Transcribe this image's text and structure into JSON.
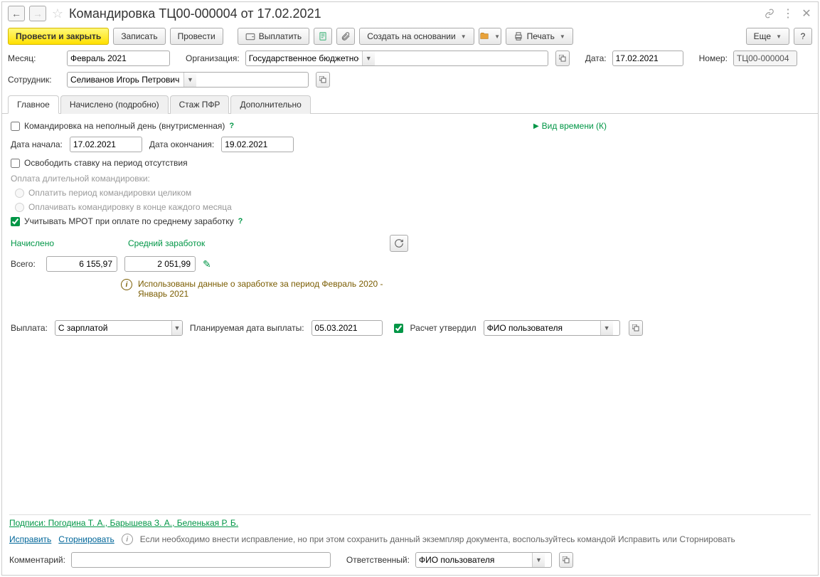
{
  "title": "Командировка ТЦ00-000004 от 17.02.2021",
  "toolbar": {
    "post_close": "Провести и закрыть",
    "save": "Записать",
    "post": "Провести",
    "pay": "Выплатить",
    "create_based": "Создать на основании",
    "print": "Печать",
    "more": "Еще"
  },
  "header": {
    "month_label": "Месяц:",
    "month_value": "Февраль 2021",
    "org_label": "Организация:",
    "org_value": "Государственное бюджетное учреждение культуры \"Театральный центр",
    "date_label": "Дата:",
    "date_value": "17.02.2021",
    "number_label": "Номер:",
    "number_value": "ТЦ00-000004",
    "employee_label": "Сотрудник:",
    "employee_value": "Селиванов Игорь Петрович"
  },
  "tabs": {
    "main": "Главное",
    "accrued": "Начислено (подробно)",
    "pfr": "Стаж ПФР",
    "extra": "Дополнительно"
  },
  "main_tab": {
    "partial_day": "Командировка на неполный день (внутрисменная)",
    "time_kind": "Вид времени (К)",
    "start_label": "Дата начала:",
    "start_value": "17.02.2021",
    "end_label": "Дата окончания:",
    "end_value": "19.02.2021",
    "free_rate": "Освободить ставку на период отсутствия",
    "long_trip_pay_label": "Оплата длительной командировки:",
    "opt_full": "Оплатить период командировки целиком",
    "opt_monthly": "Оплачивать командировку в конце каждого месяца",
    "mrot": "Учитывать МРОТ при оплате по среднему заработку",
    "accrued_header": "Начислено",
    "avg_header": "Средний заработок",
    "total_label": "Всего:",
    "total_value": "6 155,97",
    "avg_value": "2 051,99",
    "info_text": "Использованы данные о заработке за период Февраль 2020 - Январь 2021",
    "payout_label": "Выплата:",
    "payout_value": "С зарплатой",
    "planned_date_label": "Планируемая дата выплаты:",
    "planned_date_value": "05.03.2021",
    "approved_label": "Расчет утвердил",
    "approved_value": "ФИО пользователя"
  },
  "footer": {
    "signatures": "Подписи: Погодина Т. А., Барышева З. А., Беленькая Р. Б.",
    "fix": "Исправить",
    "storno": "Сторнировать",
    "hint": "Если необходимо внести исправление, но при этом сохранить данный экземпляр документа, воспользуйтесь командой Исправить или Сторнировать",
    "comment_label": "Комментарий:",
    "resp_label": "Ответственный:",
    "resp_value": "ФИО пользователя"
  }
}
